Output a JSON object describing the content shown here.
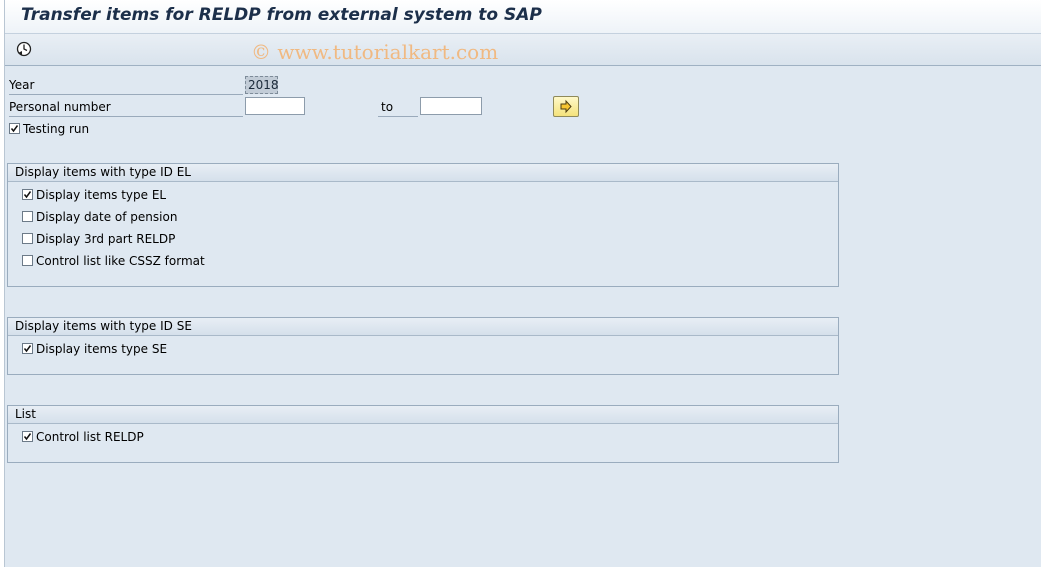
{
  "window": {
    "title": "Transfer items for RELDP from external system to SAP"
  },
  "toolbar": {
    "execute_icon": "execute-clock-icon",
    "watermark": "© www.tutorialkart.com"
  },
  "selection": {
    "year_label": "Year",
    "year_value": "2018",
    "personal_number_label": "Personal number",
    "personal_number_from": "",
    "to_label": "to",
    "personal_number_to": "",
    "multiple_selection_icon": "arrow-right-icon",
    "testing_run_label": "Testing run",
    "testing_run_checked": true
  },
  "groups": [
    {
      "title": "Display items with type ID EL",
      "items": [
        {
          "label": "Display items type EL",
          "checked": true
        },
        {
          "label": "Display date of pension",
          "checked": false
        },
        {
          "label": "Display 3rd part RELDP",
          "checked": false
        },
        {
          "label": "Control list like CSSZ format",
          "checked": false
        }
      ]
    },
    {
      "title": "Display items with type ID SE",
      "items": [
        {
          "label": "Display items type SE",
          "checked": true
        }
      ]
    },
    {
      "title": "List",
      "items": [
        {
          "label": "Control list RELDP",
          "checked": true
        }
      ]
    }
  ],
  "colors": {
    "background": "#dfe8f1",
    "title_text": "#1c2f4a",
    "watermark": "#f0b982"
  }
}
